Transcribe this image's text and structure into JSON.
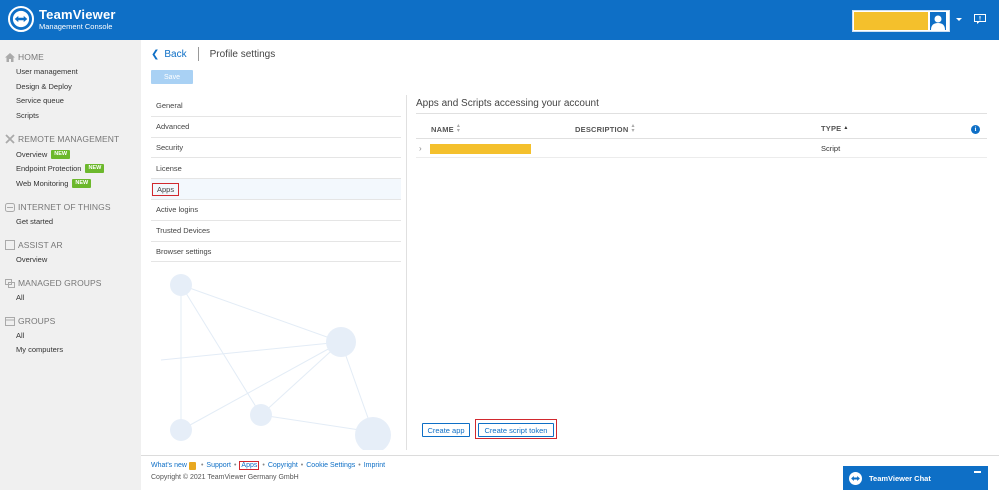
{
  "header": {
    "brand_name": "TeamViewer",
    "brand_sub": "Management Console"
  },
  "sidebar": {
    "sections": [
      {
        "label": "HOME",
        "icon": "home-icon",
        "items": [
          {
            "label": "User management"
          },
          {
            "label": "Design & Deploy"
          },
          {
            "label": "Service queue"
          },
          {
            "label": "Scripts"
          }
        ]
      },
      {
        "label": "REMOTE MANAGEMENT",
        "icon": "wrench-icon",
        "items": [
          {
            "label": "Overview",
            "badge": "NEW"
          },
          {
            "label": "Endpoint Protection",
            "badge": "NEW"
          },
          {
            "label": "Web Monitoring",
            "badge": "NEW"
          }
        ]
      },
      {
        "label": "INTERNET OF THINGS",
        "icon": "iot-icon",
        "items": [
          {
            "label": "Get started"
          }
        ]
      },
      {
        "label": "ASSIST AR",
        "icon": "ar-icon",
        "items": [
          {
            "label": "Overview"
          }
        ]
      },
      {
        "label": "MANAGED GROUPS",
        "icon": "managed-groups-icon",
        "items": [
          {
            "label": "All"
          }
        ]
      },
      {
        "label": "GROUPS",
        "icon": "groups-icon",
        "items": [
          {
            "label": "All"
          },
          {
            "label": "My computers"
          }
        ]
      }
    ]
  },
  "breadcrumb": {
    "back": "Back",
    "title": "Profile settings"
  },
  "save_label": "Save",
  "tabs": [
    {
      "label": "General"
    },
    {
      "label": "Advanced"
    },
    {
      "label": "Security"
    },
    {
      "label": "License"
    },
    {
      "label": "Apps",
      "active": true
    },
    {
      "label": "Active logins"
    },
    {
      "label": "Trusted Devices"
    },
    {
      "label": "Browser settings"
    }
  ],
  "apps_panel": {
    "title": "Apps and Scripts accessing your account",
    "columns": {
      "name": "NAME",
      "description": "DESCRIPTION",
      "type": "TYPE"
    },
    "rows": [
      {
        "name": "",
        "description": "",
        "type": "Script"
      }
    ],
    "create_app": "Create app",
    "create_token": "Create script token"
  },
  "footer": {
    "links": [
      "What's new",
      "Support",
      "Apps",
      "Copyright",
      "Cookie Settings",
      "Imprint"
    ],
    "copyright": "Copyright © 2021 TeamViewer Germany GmbH"
  },
  "chat": {
    "label": "TeamViewer Chat"
  },
  "colors": {
    "brand": "#0e6fc6",
    "accent_new": "#6cb82c",
    "highlight": "#d1282e",
    "redacted": "#f4c02c"
  }
}
